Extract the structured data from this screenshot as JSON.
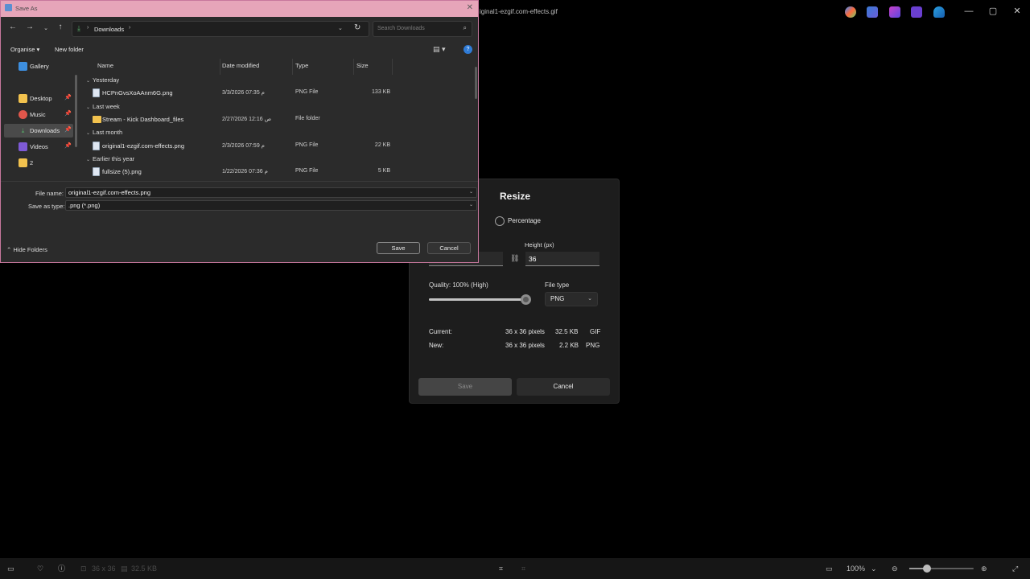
{
  "viewer": {
    "title": "iginal1-ezgif.com-effects.gif",
    "window_controls": {
      "minimize": "—",
      "maximize": "▢",
      "close": "✕"
    },
    "taskbar_icons": [
      "copilot-icon",
      "edit-icon",
      "designer-icon",
      "clipchamp-icon",
      "onedrive-icon"
    ],
    "bottom": {
      "dimensions": "36 x 36",
      "filesize": "32.5 KB",
      "zoom": "100%",
      "zoom_level": 0.26
    }
  },
  "resize": {
    "title": "Resize",
    "percentage_label": "Percentage",
    "height_label": "Height (px)",
    "height_value": "36",
    "quality_label": "Quality: 100% (High)",
    "quality_value": 1.0,
    "filetype_label": "File type",
    "filetype_value": "PNG",
    "current_label": "Current:",
    "current_dims": "36 x 36 pixels",
    "current_size": "32.5 KB",
    "current_type": "GIF",
    "new_label": "New:",
    "new_dims": "36 x 36 pixels",
    "new_size": "2.2 KB",
    "new_type": "PNG",
    "save_label": "Save",
    "cancel_label": "Cancel"
  },
  "dialog": {
    "title": "Save As",
    "close": "✕",
    "address": "Downloads",
    "search_placeholder": "Search Downloads",
    "organise": "Organise ▾",
    "new_folder": "New folder",
    "help": "?",
    "sidebar": [
      {
        "label": "Gallery",
        "icon": "gallery-icon",
        "color": "#3d8fe0",
        "pin": false
      },
      {
        "label": "Desktop",
        "icon": "folder-icon",
        "color": "#f2c24e",
        "pin": true
      },
      {
        "label": "Music",
        "icon": "music-icon",
        "color": "#e0564b",
        "pin": true
      },
      {
        "label": "Downloads",
        "icon": "download-icon",
        "color": "#58b16a",
        "pin": true,
        "selected": true
      },
      {
        "label": "Videos",
        "icon": "video-icon",
        "color": "#7e5ad6",
        "pin": true
      },
      {
        "label": "2",
        "icon": "folder-icon",
        "color": "#f2c24e",
        "pin": false
      }
    ],
    "columns": {
      "name": "Name",
      "date": "Date modified",
      "type": "Type",
      "size": "Size"
    },
    "groups": {
      "g1": "Yesterday",
      "g2": "Last week",
      "g3": "Last month",
      "g4": "Earlier this year"
    },
    "files": [
      {
        "name": "HCPnGvsXoAAnm6G.png",
        "date": "3/3/2026 07:35 م",
        "type": "PNG File",
        "size": "133 KB",
        "kind": "png"
      },
      {
        "name": "Stream - Kick Dashboard_files",
        "date": "2/27/2026 12:16 ص",
        "type": "File folder",
        "size": "",
        "kind": "folder"
      },
      {
        "name": "original1-ezgif.com-effects.png",
        "date": "2/3/2026 07:59 م",
        "type": "PNG File",
        "size": "22 KB",
        "kind": "png"
      },
      {
        "name": "fullsize (5).png",
        "date": "1/22/2026 07:36 م",
        "type": "PNG File",
        "size": "5 KB",
        "kind": "png"
      }
    ],
    "filename_label": "File name:",
    "filename_value": "original1-ezgif.com-effects.png",
    "savetype_label": "Save as type:",
    "savetype_value": ".png (*.png)",
    "hide_folders": "Hide Folders",
    "save_label": "Save",
    "cancel_label": "Cancel"
  }
}
